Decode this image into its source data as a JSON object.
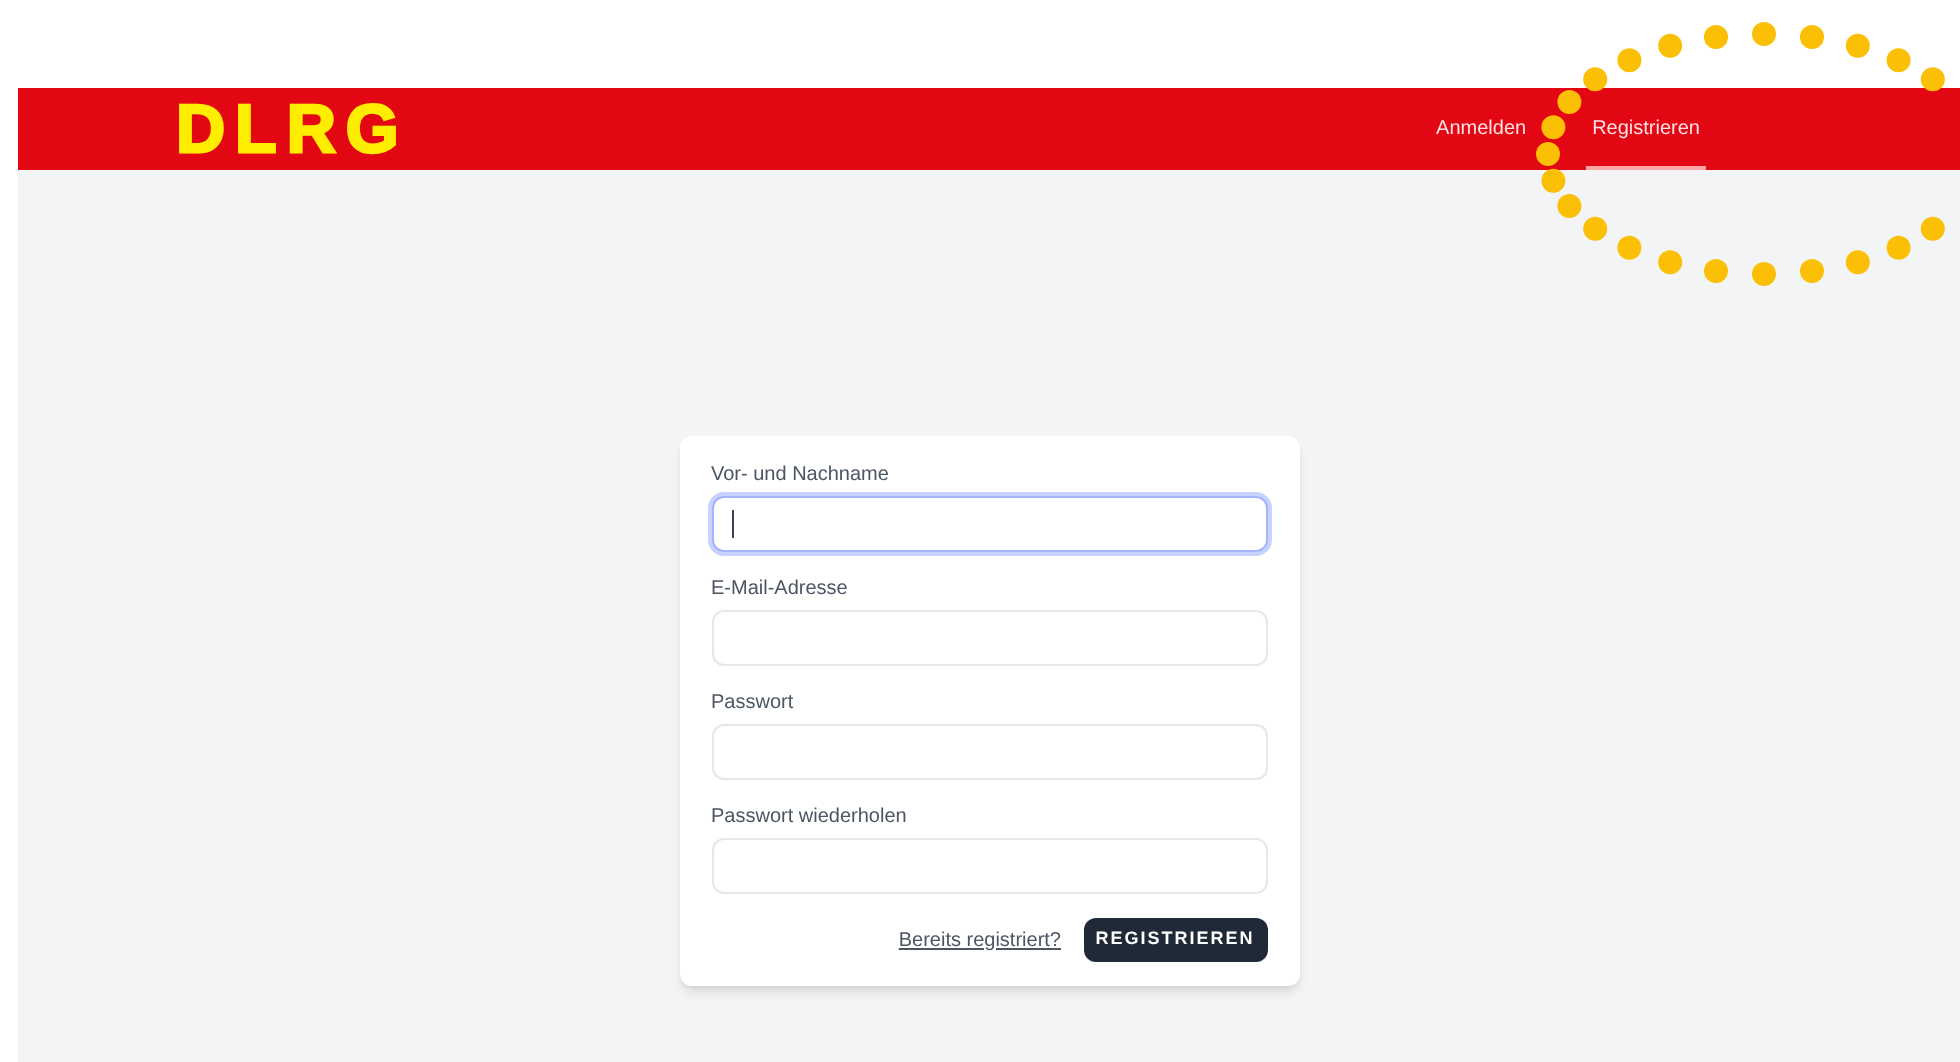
{
  "header": {
    "logo": "DLRG",
    "nav": [
      {
        "label": "Anmelden",
        "selected": false
      },
      {
        "label": "Registrieren",
        "selected": true
      }
    ]
  },
  "form": {
    "fields": [
      {
        "label": "Vor- und Nachname",
        "focused": true
      },
      {
        "label": "E-Mail-Adresse",
        "focused": false
      },
      {
        "label": "Passwort",
        "focused": false
      },
      {
        "label": "Passwort wiederholen",
        "focused": false
      }
    ],
    "link": "Bereits registriert?",
    "submit": "REGISTRIEREN"
  }
}
